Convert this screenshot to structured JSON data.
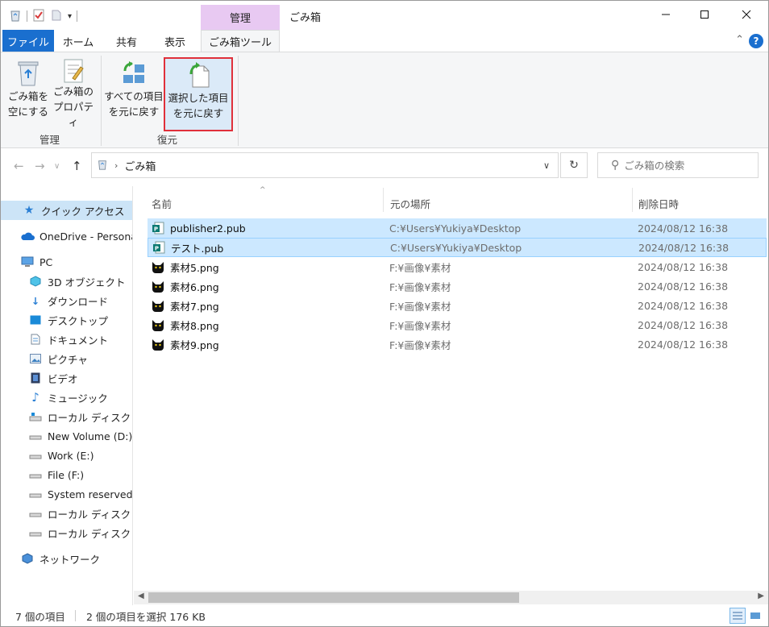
{
  "titlebar": {
    "context_tab": "管理",
    "title": "ごみ箱",
    "minimize": "—",
    "maximize": "☐",
    "close": "✕"
  },
  "tabs": {
    "file": "ファイル",
    "home": "ホーム",
    "share": "共有",
    "view": "表示",
    "recycle_tools": "ごみ箱ツール"
  },
  "ribbon": {
    "empty_bin": [
      "ごみ箱を",
      "空にする"
    ],
    "bin_properties": [
      "ごみ箱の",
      "プロパティ"
    ],
    "restore_all": [
      "すべての項目",
      "を元に戻す"
    ],
    "restore_selected": [
      "選択した項目",
      "を元に戻す"
    ],
    "group_manage": "管理",
    "group_restore": "復元"
  },
  "address": {
    "path": "ごみ箱",
    "search_placeholder": "ごみ箱の検索"
  },
  "nav": {
    "items": [
      {
        "label": "クイック アクセス"
      },
      {
        "label": "OneDrive - Personal"
      },
      {
        "label": "PC"
      },
      {
        "label": "3D オブジェクト"
      },
      {
        "label": "ダウンロード"
      },
      {
        "label": "デスクトップ"
      },
      {
        "label": "ドキュメント"
      },
      {
        "label": "ピクチャ"
      },
      {
        "label": "ビデオ"
      },
      {
        "label": "ミュージック"
      },
      {
        "label": "ローカル ディスク (C:)"
      },
      {
        "label": "New Volume (D:)"
      },
      {
        "label": "Work (E:)"
      },
      {
        "label": "File (F:)"
      },
      {
        "label": "System reserved (G:)"
      },
      {
        "label": "ローカル ディスク (H:)"
      },
      {
        "label": "ローカル ディスク (I:)"
      },
      {
        "label": "ネットワーク"
      }
    ]
  },
  "columns": {
    "name": "名前",
    "original_location": "元の場所",
    "date_deleted": "削除日時"
  },
  "files": [
    {
      "name": "publisher2.pub",
      "location": "C:¥Users¥Yukiya¥Desktop",
      "date": "2024/08/12 16:38",
      "icon": "publisher-icon"
    },
    {
      "name": "テスト.pub",
      "location": "C:¥Users¥Yukiya¥Desktop",
      "date": "2024/08/12 16:38",
      "icon": "publisher-icon"
    },
    {
      "name": "素材5.png",
      "location": "F:¥画像¥素材",
      "date": "2024/08/12 16:38",
      "icon": "cat-image-icon"
    },
    {
      "name": "素材6.png",
      "location": "F:¥画像¥素材",
      "date": "2024/08/12 16:38",
      "icon": "cat-image-icon"
    },
    {
      "name": "素材7.png",
      "location": "F:¥画像¥素材",
      "date": "2024/08/12 16:38",
      "icon": "cat-image-icon"
    },
    {
      "name": "素材8.png",
      "location": "F:¥画像¥素材",
      "date": "2024/08/12 16:38",
      "icon": "cat-image-icon"
    },
    {
      "name": "素材9.png",
      "location": "F:¥画像¥素材",
      "date": "2024/08/12 16:38",
      "icon": "cat-image-icon"
    }
  ],
  "status": {
    "item_count": "7 個の項目",
    "selection": "2 個の項目を選択  176 KB"
  },
  "colors": {
    "accent": "#1a6fcf",
    "context_tab": "#e8c9f2",
    "selection": "#cce8ff",
    "highlight_border": "#e0303a"
  }
}
